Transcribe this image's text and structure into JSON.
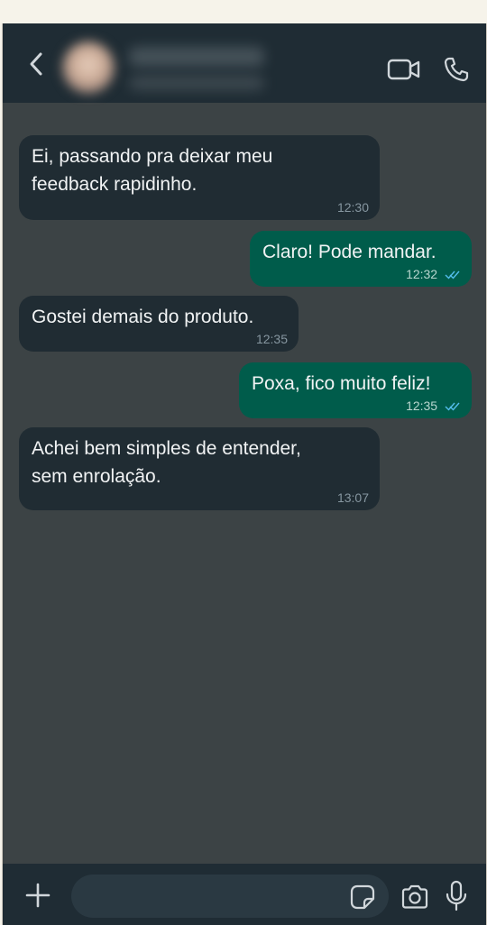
{
  "header": {
    "back_icon": "chevron-left-icon",
    "video_icon": "video-camera-icon",
    "call_icon": "phone-icon"
  },
  "messages": [
    {
      "direction": "incoming",
      "text_lines": [
        "Ei, passando pra deixar meu",
        "feedback rapidinho."
      ],
      "time": "12:30"
    },
    {
      "direction": "outgoing",
      "text_lines": [
        "Claro! Pode mandar."
      ],
      "time": "12:32",
      "status": "read"
    },
    {
      "direction": "incoming",
      "text_lines": [
        "Gostei demais do produto."
      ],
      "time": "12:35"
    },
    {
      "direction": "outgoing",
      "text_lines": [
        "Poxa, fico muito feliz!"
      ],
      "time": "12:35",
      "status": "read"
    },
    {
      "direction": "incoming",
      "text_lines": [
        "Achei bem simples de entender,",
        "sem enrolação."
      ],
      "time": "13:07"
    }
  ],
  "footer": {
    "input_value": "",
    "input_placeholder": "",
    "plus_icon": "plus-icon",
    "sticker_icon": "sticker-icon",
    "camera_icon": "camera-icon",
    "mic_icon": "microphone-icon"
  },
  "colors": {
    "chat_background": "#3c4345",
    "bar_background": "#1f2c34",
    "incoming_bubble": "#202c33",
    "outgoing_bubble": "#005c4b",
    "read_ticks": "#53bdeb"
  }
}
